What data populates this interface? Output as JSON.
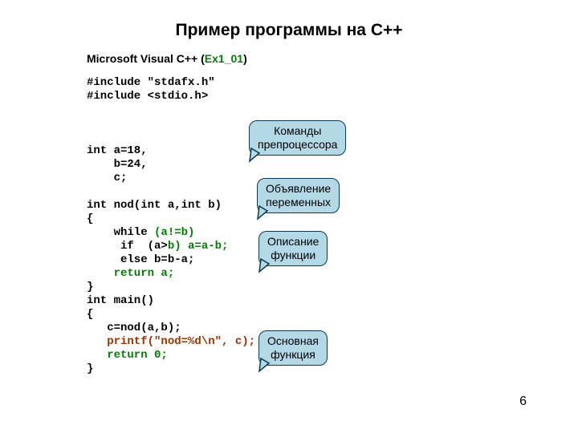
{
  "title": "Пример программы на С++",
  "subtitle_prefix": "Microsoft Visual C++ (",
  "subtitle_green": "Ex1_01",
  "subtitle_suffix": ")",
  "code": {
    "l1": "#include \"stdafx.h\"",
    "l2": "#include <stdio.h>",
    "l3": "",
    "l4": "",
    "l5": "",
    "l6": "int a=18,",
    "l7": "    b=24,",
    "l8": "    c;",
    "l9": "",
    "l10": "int nod(int a,int b)",
    "l11": "{",
    "l12a": "    while ",
    "l12b": "(a!=b)",
    "l13a": "     if  (a>",
    "l13b": "b) a=a-b;",
    "l14": "     else b=b-a;",
    "l15": "    return a;",
    "l16": "}",
    "l17": "int main()",
    "l18": "{",
    "l19": "   c=nod(a,b);",
    "l20": "   printf(\"nod=%d\\n\", c);",
    "l21": "   return 0;",
    "l22": "}"
  },
  "callouts": {
    "c1_l1": "Команды",
    "c1_l2": "препроцессора",
    "c2_l1": "Объявление",
    "c2_l2": "переменных",
    "c3_l1": "Описание",
    "c3_l2": "функции",
    "c4_l1": "Основная",
    "c4_l2": "функция"
  },
  "page_number": "6"
}
